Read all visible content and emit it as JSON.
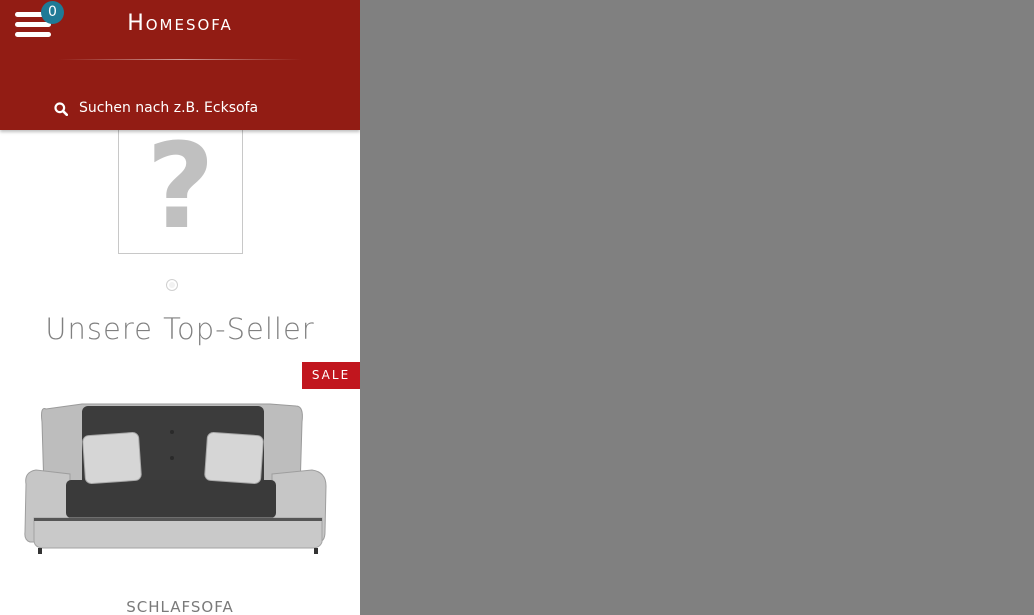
{
  "header": {
    "brand": "Homesofa",
    "cart_count": "0",
    "search_placeholder": "Suchen nach z.B. Ecksofa",
    "bg_color": "#921c14"
  },
  "slider": {
    "placeholder_glyph": "?"
  },
  "topseller": {
    "title": "Unsere Top-Seller",
    "product": {
      "badge": "SALE",
      "name": "SCHLAFSOFA"
    }
  },
  "icons": [
    "menu-icon",
    "search-icon",
    "missing-image-icon",
    "sofa-image"
  ]
}
